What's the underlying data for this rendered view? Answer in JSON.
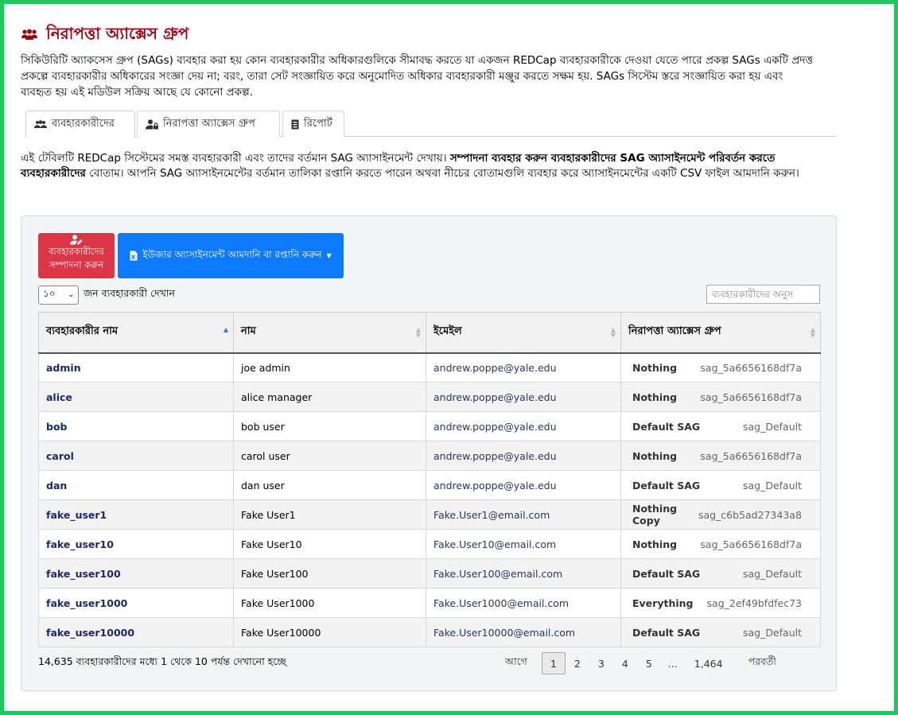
{
  "page": {
    "title": "নিরাপত্তা অ্যাক্সেস গ্রুপ",
    "intro": "সিকিউরিটি অ্যাকসেস গ্রুপ (SAGs) ব্যবহার করা হয় কোন ব্যবহারকারীর অধিকারগুলিকে সীমাবদ্ধ করতে যা একজন REDCap ব্যবহারকারীকে দেওয়া যেতে পারে প্রকল্প SAGs একটি প্রদত্ত প্রকল্পে ব্যবহারকারীর অধিকারের সংজ্ঞা দেয় না; বরং, তারা সেট সংজ্ঞায়িত করে অনুমোদিত অধিকার ব্যবহারকারী মঞ্জুর করতে সক্ষম হয়. SAGs সিস্টেম স্তরে সংজ্ঞায়িত করা হয় এবং ব্যবহৃত হয় এই মডিউল সক্রিয় আছে যে কোনো প্রকল্প."
  },
  "tabs": [
    {
      "label": "ব্যবহারকারীদের",
      "icon": "users-icon"
    },
    {
      "label": "নিরাপত্তা অ্যাক্সেস গ্রুপ",
      "icon": "user-lock-icon"
    },
    {
      "label": "রিপোর্ট",
      "icon": "report-icon"
    }
  ],
  "description": {
    "part1": "এই টেবিলটি REDCap সিস্টেমের সমস্ত ব্যবহারকারী এবং তাদের বর্তমান SAG অ্যাসাইনমেন্ট দেখায়। ",
    "bold1": "সম্পাদনা ব্যবহার করুন ব্যবহারকারীদের SAG অ্যাসাইনমেন্ট পরিবর্তন করতে ব্যবহারকারীদের",
    "part2": " বোতাম। আপনি SAG অ্যাসাইনমেন্টের বর্তমান তালিকা রপ্তানি করতে পারেন অথবা নীচের বোতামগুলি ব্যবহার করে অ্যাসাইনমেন্টের একটি CSV ফাইল আমদানি করুন।"
  },
  "toolbar": {
    "edit_users_label": "ব্যবহারকারীদের সম্পাদনা করুন",
    "import_export_label": "ইউজার অ্যাসাইনমেন্ট আমদানি বা রপ্তানি করুন",
    "length_value": "১০",
    "length_suffix": "জন ব্যবহারকারী দেখান",
    "search_placeholder": "ব্যবহারকারীদের অনুস"
  },
  "table": {
    "headers": [
      "ব্যবহারকারীর নাম",
      "নাম",
      "ইমেইল",
      "নিরাপত্তা অ্যাক্সেস গ্রুপ"
    ],
    "rows": [
      {
        "username": "admin",
        "name": "joe admin",
        "email": "andrew.poppe@yale.edu",
        "sag_name": "Nothing",
        "sag_id": "sag_5a6656168df7a"
      },
      {
        "username": "alice",
        "name": "alice manager",
        "email": "andrew.poppe@yale.edu",
        "sag_name": "Nothing",
        "sag_id": "sag_5a6656168df7a"
      },
      {
        "username": "bob",
        "name": "bob user",
        "email": "andrew.poppe@yale.edu",
        "sag_name": "Default SAG",
        "sag_id": "sag_Default"
      },
      {
        "username": "carol",
        "name": "carol user",
        "email": "andrew.poppe@yale.edu",
        "sag_name": "Nothing",
        "sag_id": "sag_5a6656168df7a"
      },
      {
        "username": "dan",
        "name": "dan user",
        "email": "andrew.poppe@yale.edu",
        "sag_name": "Default SAG",
        "sag_id": "sag_Default"
      },
      {
        "username": "fake_user1",
        "name": "Fake User1",
        "email": "Fake.User1@email.com",
        "sag_name": "Nothing Copy",
        "sag_id": "sag_c6b5ad27343a8"
      },
      {
        "username": "fake_user10",
        "name": "Fake User10",
        "email": "Fake.User10@email.com",
        "sag_name": "Nothing",
        "sag_id": "sag_5a6656168df7a"
      },
      {
        "username": "fake_user100",
        "name": "Fake User100",
        "email": "Fake.User100@email.com",
        "sag_name": "Default SAG",
        "sag_id": "sag_Default"
      },
      {
        "username": "fake_user1000",
        "name": "Fake User1000",
        "email": "Fake.User1000@email.com",
        "sag_name": "Everything",
        "sag_id": "sag_2ef49bfdfec73"
      },
      {
        "username": "fake_user10000",
        "name": "Fake User10000",
        "email": "Fake.User10000@email.com",
        "sag_name": "Default SAG",
        "sag_id": "sag_Default"
      }
    ]
  },
  "footer": {
    "info": "14,635 ব্যবহারকারীদের মধ্যে 1 থেকে 10 পর্যন্ত দেখানো হচ্ছে",
    "prev": "আগে",
    "pages": [
      "1",
      "2",
      "3",
      "4",
      "5",
      "…",
      "1,464"
    ],
    "next": "পরবর্তী"
  },
  "colors": {
    "title": "#a00010",
    "edit_button": "#dc3545",
    "import_button": "#0d7bff"
  }
}
